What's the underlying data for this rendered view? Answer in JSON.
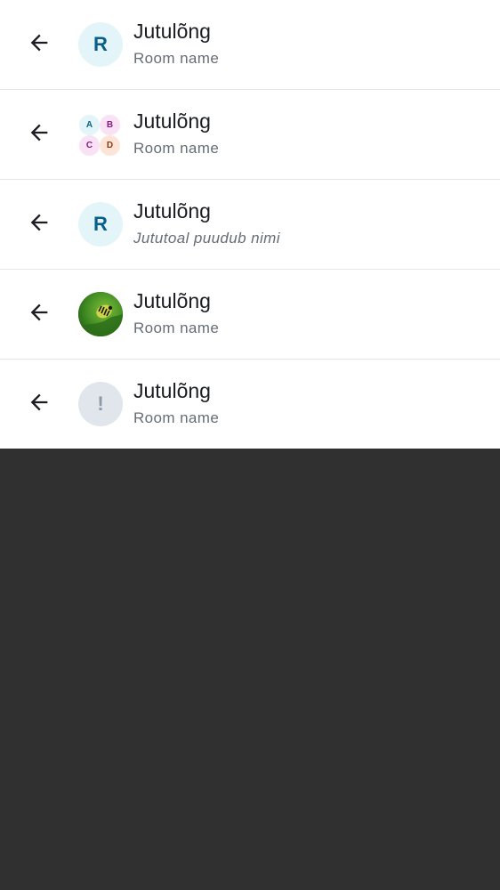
{
  "rows": [
    {
      "title": "Jutulõng",
      "subtitle": "Room name",
      "avatar": {
        "type": "letter",
        "letter": "R"
      }
    },
    {
      "title": "Jutulõng",
      "subtitle": "Room name",
      "avatar": {
        "type": "cluster",
        "letters": [
          "A",
          "B",
          "C",
          "D"
        ]
      }
    },
    {
      "title": "Jutulõng",
      "subtitle": "Jututoal puudub nimi",
      "avatar": {
        "type": "letter",
        "letter": "R"
      }
    },
    {
      "title": "Jutulõng",
      "subtitle": "Room name",
      "avatar": {
        "type": "photo",
        "icon": "caterpillar-photo"
      }
    },
    {
      "title": "Jutulõng",
      "subtitle": "Room name",
      "avatar": {
        "type": "unknown",
        "glyph": "!"
      }
    }
  ],
  "icons": {
    "back": "arrow-left-icon"
  },
  "colors": {
    "list_background": "#ffffff",
    "page_background": "#303030",
    "avatar_letter_bg": "#e3f5f8",
    "avatar_letter_fg": "#0a5f8a",
    "title": "#1b1d22",
    "subtitle": "#656d77",
    "divider": "#e4e6ea"
  }
}
